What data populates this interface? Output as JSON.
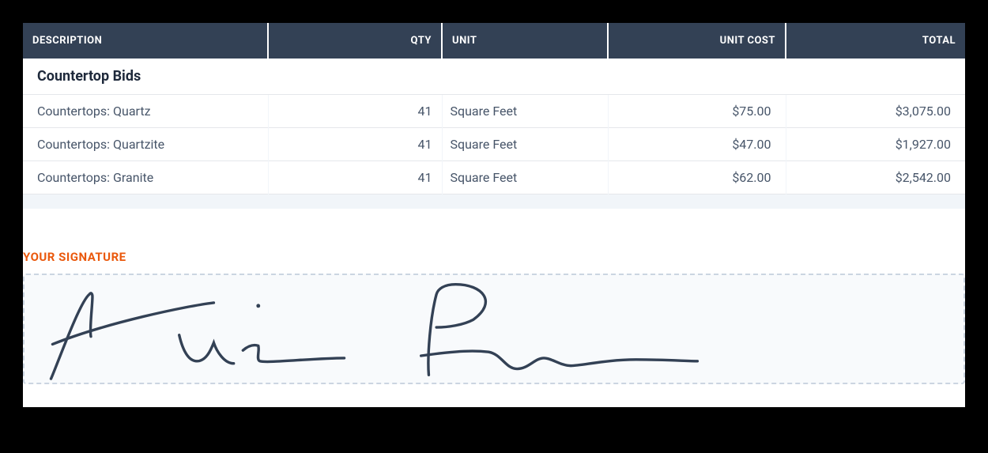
{
  "table": {
    "headers": {
      "description": "DESCRIPTION",
      "qty": "QTY",
      "unit": "UNIT",
      "unit_cost": "UNIT COST",
      "total": "TOTAL"
    },
    "section_title": "Countertop Bids",
    "rows": [
      {
        "description": "Countertops: Quartz",
        "qty": "41",
        "unit": "Square Feet",
        "unit_cost": "$75.00",
        "total": "$3,075.00"
      },
      {
        "description": "Countertops: Quartzite",
        "qty": "41",
        "unit": "Square Feet",
        "unit_cost": "$47.00",
        "total": "$1,927.00"
      },
      {
        "description": "Countertops: Granite",
        "qty": "41",
        "unit": "Square Feet",
        "unit_cost": "$62.00",
        "total": "$2,542.00"
      }
    ]
  },
  "signature": {
    "label": "YOUR SIGNATURE"
  },
  "colors": {
    "header_bg": "#334155",
    "accent": "#ea580c",
    "text": "#475569",
    "border": "#e5e7eb",
    "signature_stroke": "#334155"
  }
}
